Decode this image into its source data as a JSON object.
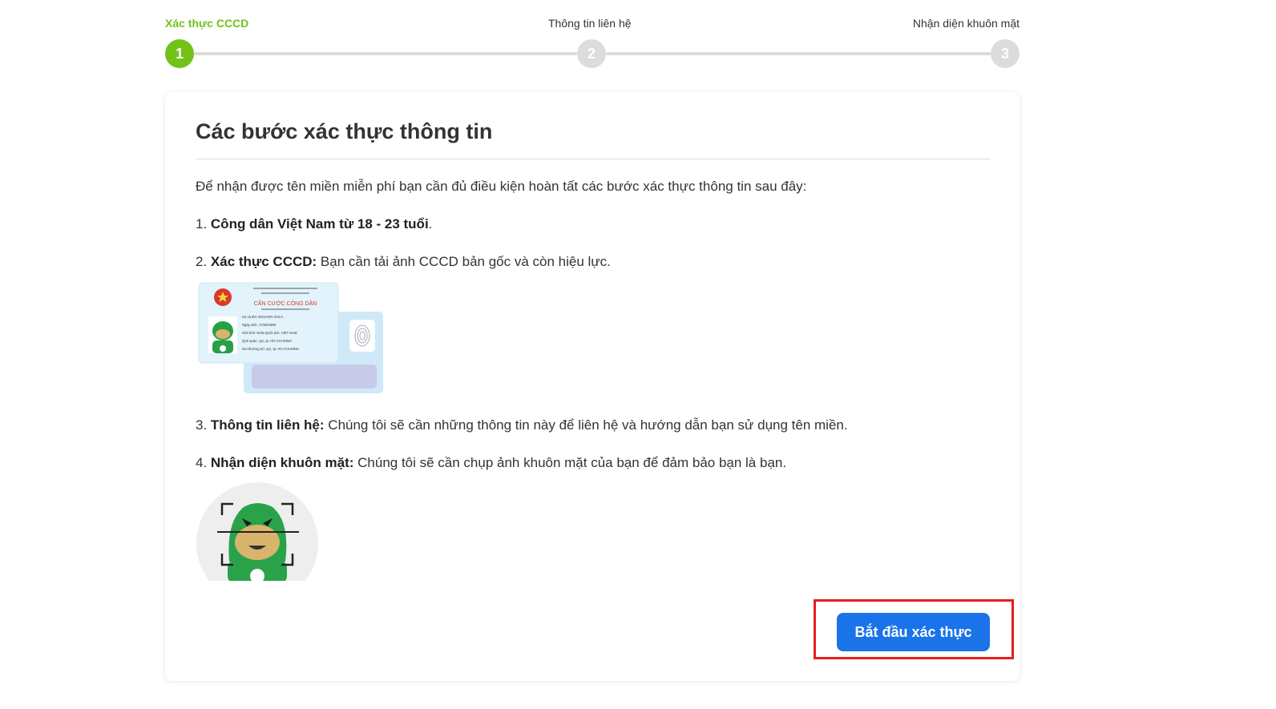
{
  "stepper": {
    "steps": [
      {
        "label": "Xác thực CCCD",
        "number": "1",
        "active": true
      },
      {
        "label": "Thông tin liên hệ",
        "number": "2",
        "active": false
      },
      {
        "label": "Nhận diện khuôn mặt",
        "number": "3",
        "active": false
      }
    ],
    "active_color": "#73c21a",
    "inactive_color": "#dcdcdc"
  },
  "card": {
    "title": "Các bước xác thực thông tin",
    "intro": "Để nhận được tên miền miễn phí bạn cần đủ điều kiện hoàn tất các bước xác thực thông tin sau đây:",
    "items": [
      {
        "prefix": "1. ",
        "bold": "Công dân Việt Nam từ 18 - 23 tuổi",
        "text": "."
      },
      {
        "prefix": "2. ",
        "bold": "Xác thực CCCD:",
        "text": " Bạn cần tải ảnh CCCD bản gốc và còn hiệu lực."
      },
      {
        "prefix": "3. ",
        "bold": "Thông tin liên hệ:",
        "text": " Chúng tôi sẽ cần những thông tin này để liên hệ và hướng dẫn bạn sử dụng tên miền."
      },
      {
        "prefix": "4. ",
        "bold": "Nhận diện khuôn mặt:",
        "text": " Chúng tôi sẽ cần chụp ảnh khuôn mặt của bạn để đảm bảo bạn là bạn."
      }
    ],
    "id_card": {
      "heading": "CĂN CƯỚC CÔNG DÂN",
      "fields": [
        "Họ và tên: NGUYEN VAN A",
        "Ngày sinh: 17/06/1998",
        "Giới tính: NAM   Quốc tịch: VIET NAM",
        "Quê quán: xyz, tp. HO CHI MINH",
        "Nơi thường trú: xyz, tp. HO CHI MINH"
      ]
    }
  },
  "actions": {
    "start_label": "Bắt đầu xác thực",
    "primary_color": "#1a73e8",
    "highlight_color": "#e61e1e"
  }
}
